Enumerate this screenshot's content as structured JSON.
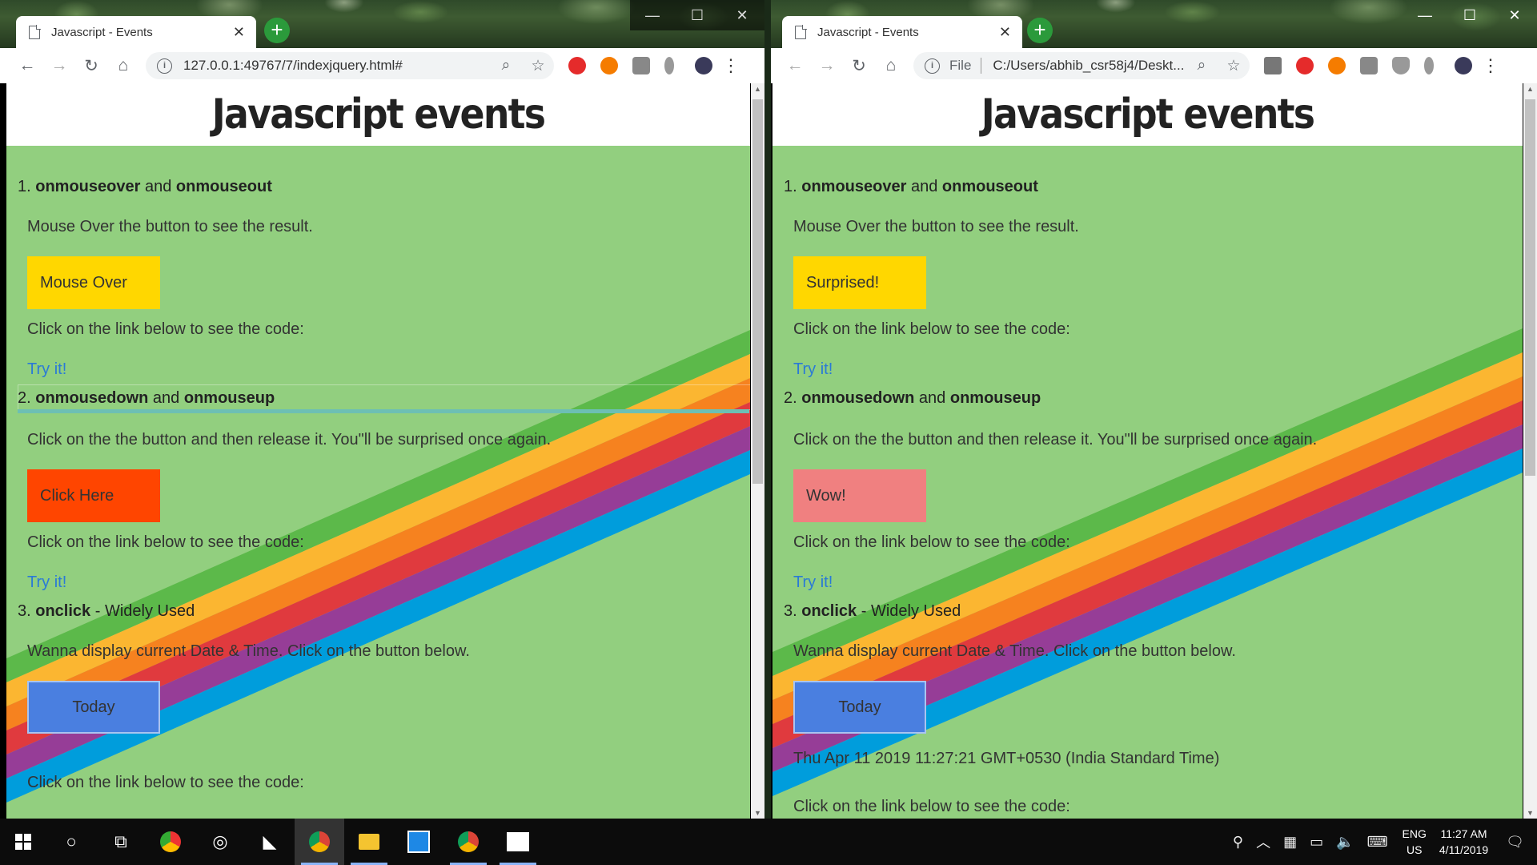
{
  "left_window": {
    "tab_title": "Javascript - Events",
    "url": "127.0.0.1:49767/7/indexjquery.html#",
    "button1_label": "Mouse Over",
    "button2_label": "Click Here",
    "show_date": false
  },
  "right_window": {
    "tab_title": "Javascript - Events",
    "file_label": "File",
    "url": "C:/Users/abhib_csr58j4/Deskt...",
    "button1_label": "Surprised!",
    "button2_label": "Wow!",
    "date_output": "Thu Apr 11 2019 11:27:21 GMT+0530 (India Standard Time)",
    "show_date": true
  },
  "page": {
    "heading": "Javascript events",
    "sections": [
      {
        "number": "1.",
        "event_a": "onmouseover",
        "joiner": "and",
        "event_b": "onmouseout",
        "description": "Mouse Over the button to see the result.",
        "code_prompt": "Click on the link below to see the code:",
        "link": "Try it!"
      },
      {
        "number": "2.",
        "event_a": "onmousedown",
        "joiner": "and",
        "event_b": "onmouseup",
        "description": "Click on the the button and then release it. You\"ll be surprised once again.",
        "code_prompt": "Click on the link below to see the code:",
        "link": "Try it!"
      },
      {
        "number": "3.",
        "event_a": "onclick",
        "joiner": "- Widely Used",
        "description": "Wanna display current Date & Time. Click on the button below.",
        "button": "Today",
        "code_prompt": "Click on the link below to see the code:"
      }
    ],
    "colors": {
      "background": "#92cf7f",
      "rainbow": [
        "#5cb94a",
        "#fbb631",
        "#f6821f",
        "#e03a3e",
        "#963d97",
        "#009ddc"
      ]
    }
  },
  "taskbar": {
    "language": "ENG",
    "region": "US",
    "time": "11:27 AM",
    "date": "4/11/2019"
  }
}
